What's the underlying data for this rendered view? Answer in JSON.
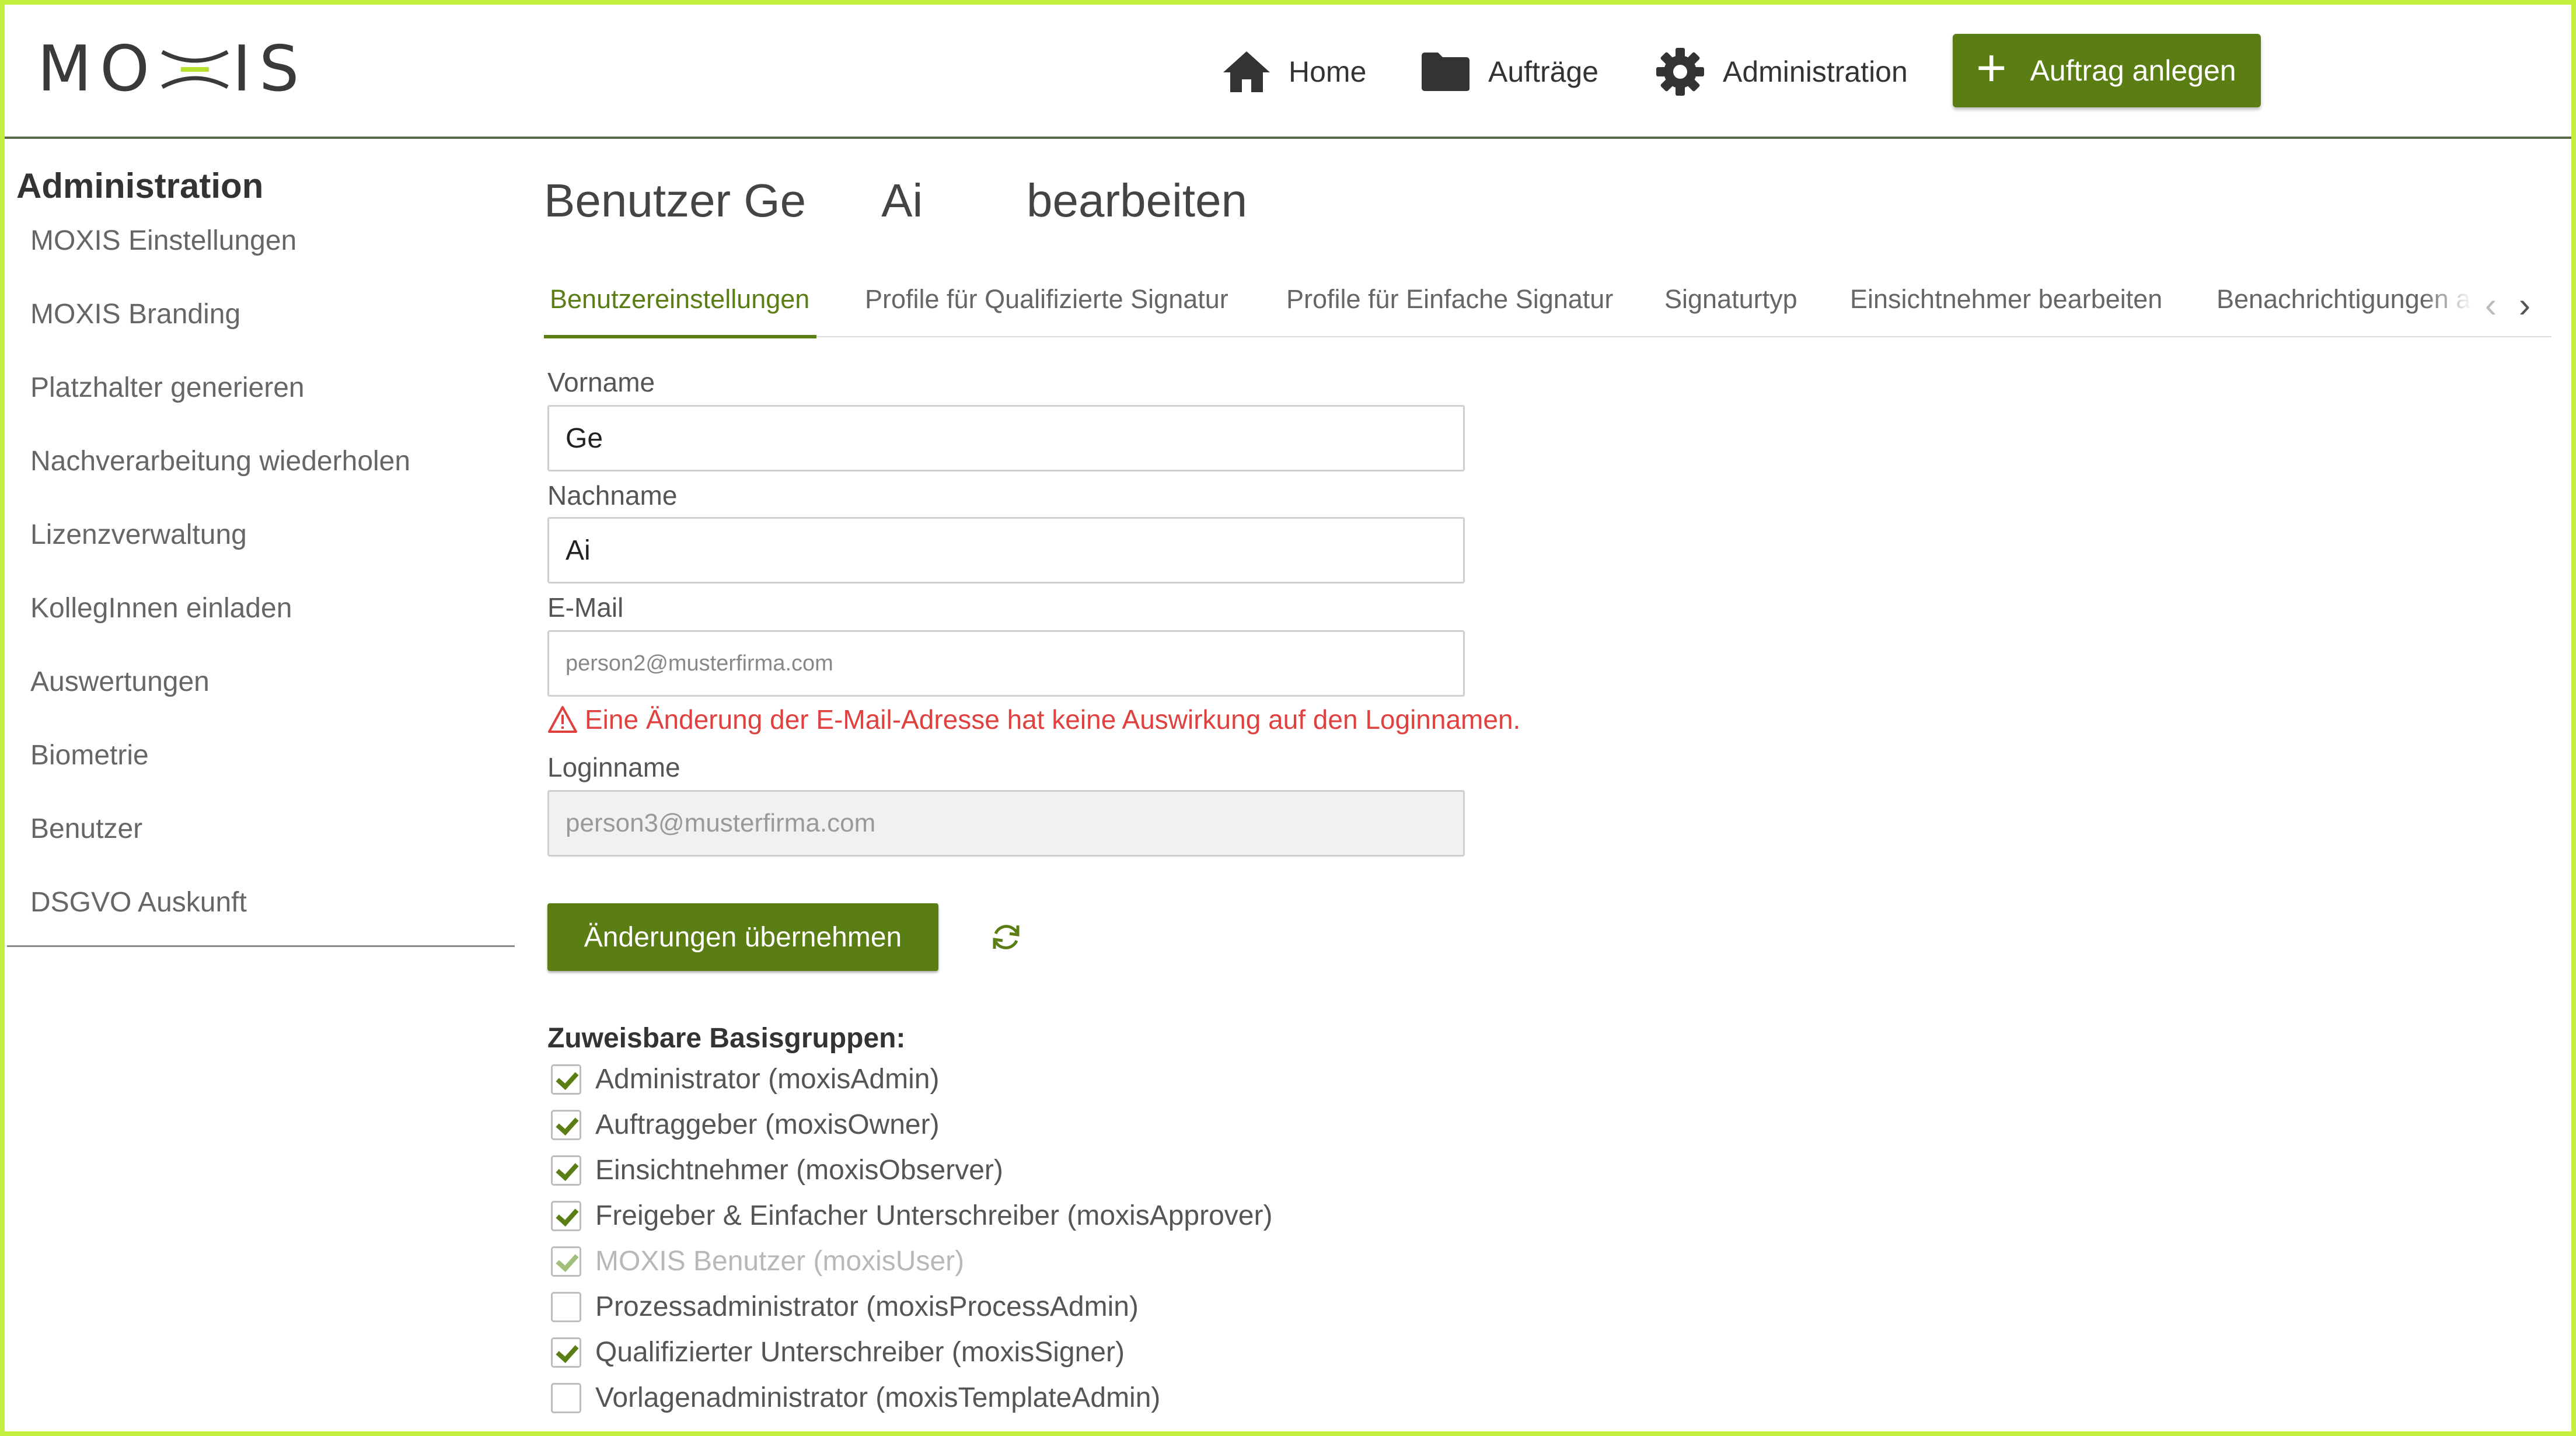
{
  "header": {
    "logo": {
      "left": "MO",
      "right": "IS"
    },
    "nav": [
      {
        "label": "Home",
        "icon": "home-icon"
      },
      {
        "label": "Aufträge",
        "icon": "folder-icon"
      },
      {
        "label": "Administration",
        "icon": "gear-icon"
      }
    ],
    "new_button": "Auftrag anlegen"
  },
  "sidebar": {
    "title": "Administration",
    "items": [
      "MOXIS Einstellungen",
      "MOXIS Branding",
      "Platzhalter generieren",
      "Nachverarbeitung wiederholen",
      "Lizenzverwaltung",
      "KollegInnen einladen",
      "Auswertungen",
      "Biometrie",
      "Benutzer",
      "DSGVO Auskunft"
    ]
  },
  "main": {
    "title": "Benutzer Ge      Ai        bearbeiten",
    "tabs": [
      "Benutzereinstellungen",
      "Profile für Qualifizierte Signatur",
      "Profile für Einfache Signatur",
      "Signaturtyp",
      "Einsichtnehmer bearbeiten",
      "Benachrichtigungen a"
    ],
    "form": {
      "firstname_label": "Vorname",
      "firstname_value": "Ge",
      "lastname_label": "Nachname",
      "lastname_value": "Ai",
      "email_label": "E-Mail",
      "email_value": "person2@musterfirma.com",
      "email_warning": "Eine Änderung der E-Mail-Adresse hat keine Auswirkung auf den Loginnamen.",
      "login_label": "Loginname",
      "login_value": "person3@musterfirma.com"
    },
    "apply_button": "Änderungen übernehmen",
    "groups_title": "Zuweisbare Basisgruppen:",
    "groups": [
      {
        "label": "Administrator (moxisAdmin)",
        "checked": true,
        "disabled": false
      },
      {
        "label": "Auftraggeber (moxisOwner)",
        "checked": true,
        "disabled": false
      },
      {
        "label": "Einsichtnehmer (moxisObserver)",
        "checked": true,
        "disabled": false
      },
      {
        "label": "Freigeber & Einfacher Unterschreiber (moxisApprover)",
        "checked": true,
        "disabled": false
      },
      {
        "label": "MOXIS Benutzer (moxisUser)",
        "checked": true,
        "disabled": true
      },
      {
        "label": "Prozessadministrator (moxisProcessAdmin)",
        "checked": false,
        "disabled": false
      },
      {
        "label": "Qualifizierter Unterschreiber (moxisSigner)",
        "checked": true,
        "disabled": false
      },
      {
        "label": "Vorlagenadministrator (moxisTemplateAdmin)",
        "checked": false,
        "disabled": false
      }
    ]
  },
  "colors": {
    "accent": "#5b7e14",
    "frame": "#c3ef3e",
    "warning": "#e0413f"
  }
}
